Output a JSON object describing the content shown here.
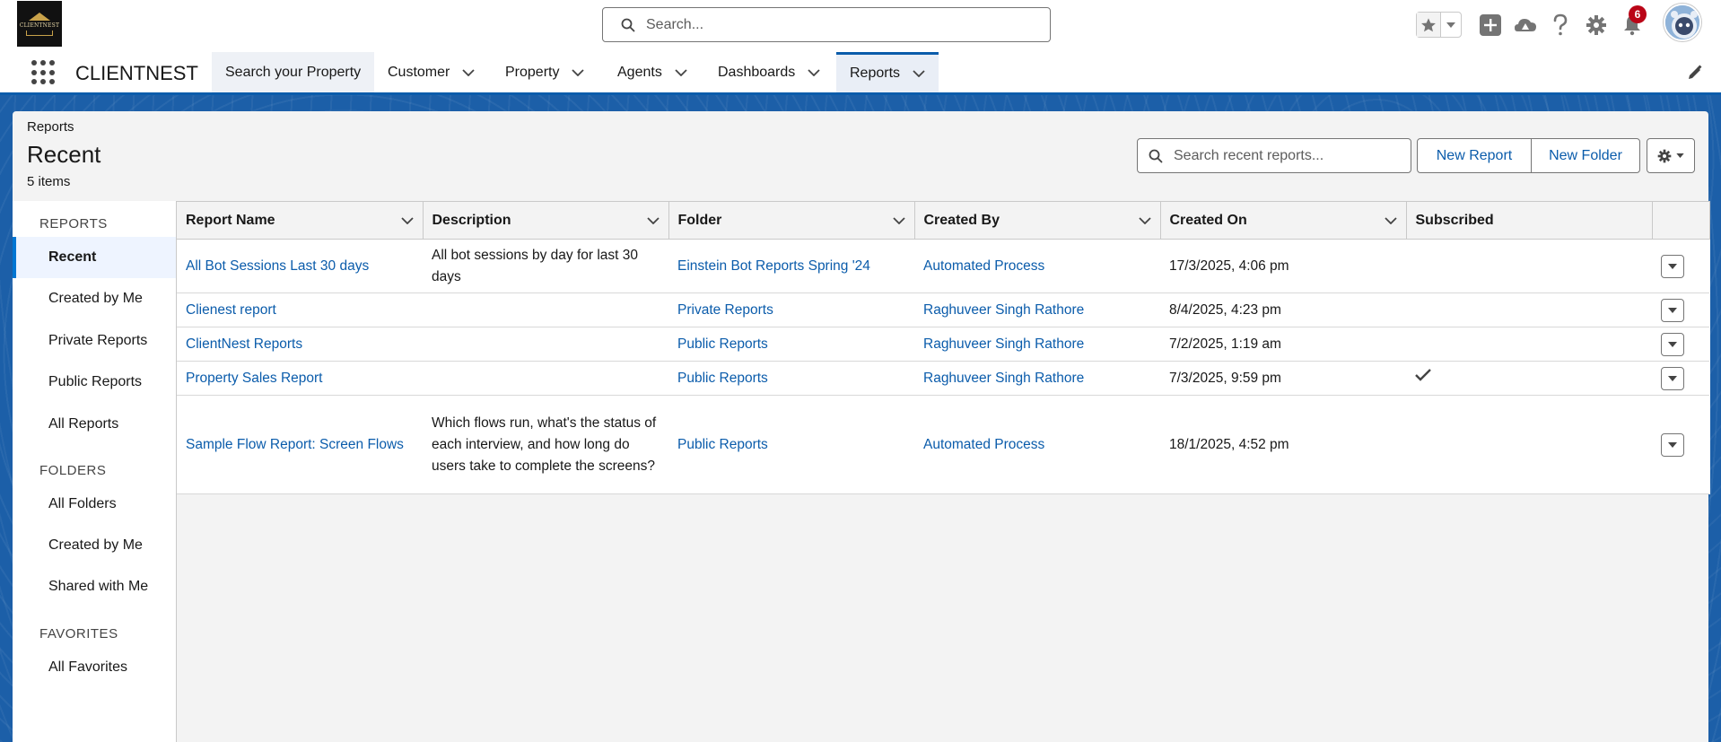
{
  "header": {
    "logo_text": "CLIENTNEST",
    "search_placeholder": "Search...",
    "notification_count": "6"
  },
  "nav": {
    "app_name": "CLIENTNEST",
    "items": [
      {
        "label": "Search your Property"
      },
      {
        "label": "Customer"
      },
      {
        "label": "Property"
      },
      {
        "label": "Agents"
      },
      {
        "label": "Dashboards"
      },
      {
        "label": "Reports"
      }
    ]
  },
  "page": {
    "breadcrumb": "Reports",
    "title": "Recent",
    "item_count": "5 items",
    "search_placeholder": "Search recent reports...",
    "new_report_label": "New Report",
    "new_folder_label": "New Folder"
  },
  "sidebar": {
    "reports_heading": "REPORTS",
    "report_items": [
      {
        "label": "Recent"
      },
      {
        "label": "Created by Me"
      },
      {
        "label": "Private Reports"
      },
      {
        "label": "Public Reports"
      },
      {
        "label": "All Reports"
      }
    ],
    "folders_heading": "FOLDERS",
    "folder_items": [
      {
        "label": "All Folders"
      },
      {
        "label": "Created by Me"
      },
      {
        "label": "Shared with Me"
      }
    ],
    "favorites_heading": "FAVORITES",
    "favorite_items": [
      {
        "label": "All Favorites"
      }
    ]
  },
  "table": {
    "columns": [
      "Report Name",
      "Description",
      "Folder",
      "Created By",
      "Created On",
      "Subscribed"
    ],
    "rows": [
      {
        "name": "All Bot Sessions Last 30 days",
        "description": "All bot sessions by day for last 30 days",
        "folder": "Einstein Bot Reports Spring '24",
        "created_by": "Automated Process",
        "created_on": "17/3/2025, 4:06 pm",
        "subscribed": false
      },
      {
        "name": "Clienest report",
        "description": "",
        "folder": "Private Reports",
        "created_by": "Raghuveer Singh Rathore",
        "created_on": "8/4/2025, 4:23 pm",
        "subscribed": false
      },
      {
        "name": "ClientNest Reports",
        "description": "",
        "folder": "Public Reports",
        "created_by": "Raghuveer Singh Rathore",
        "created_on": "7/2/2025, 1:19 am",
        "subscribed": false
      },
      {
        "name": "Property Sales Report",
        "description": "",
        "folder": "Public Reports",
        "created_by": "Raghuveer Singh Rathore",
        "created_on": "7/3/2025, 9:59 pm",
        "subscribed": true
      },
      {
        "name": "Sample Flow Report: Screen Flows",
        "description": "Which flows run, what's the status of each interview, and how long do users take to complete the screens?",
        "folder": "Public Reports",
        "created_by": "Automated Process",
        "created_on": "18/1/2025, 4:52 pm",
        "subscribed": false
      }
    ]
  },
  "colors": {
    "brand_blue": "#0b5cab",
    "background_blue": "#1c5fa8",
    "notification_red": "#ba0517"
  }
}
